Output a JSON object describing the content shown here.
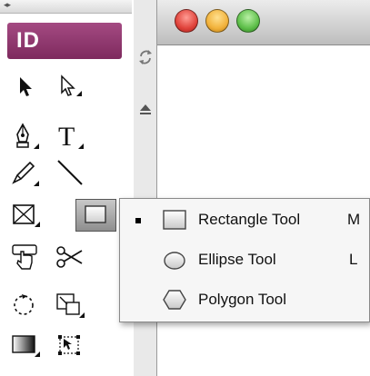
{
  "toolbox": {
    "logo_text": "ID",
    "tools": [
      {
        "name": "selection-tool",
        "icon": "arrow-icon"
      },
      {
        "name": "direct-selection-tool",
        "icon": "hollow-arrow-icon"
      },
      {
        "name": "pen-tool",
        "icon": "pen-icon"
      },
      {
        "name": "type-tool",
        "icon": "type-icon"
      },
      {
        "name": "pencil-tool",
        "icon": "pencil-icon"
      },
      {
        "name": "line-tool",
        "icon": "line-icon"
      },
      {
        "name": "rectangle-frame-tool",
        "icon": "frame-icon"
      },
      {
        "name": "rectangle-tool",
        "icon": "rectangle-icon",
        "selected": true
      },
      {
        "name": "button-tool",
        "icon": "hand-button-icon"
      },
      {
        "name": "scissors-tool",
        "icon": "scissors-icon"
      },
      {
        "name": "rotate-tool",
        "icon": "rotate-icon"
      },
      {
        "name": "scale-tool",
        "icon": "scale-icon"
      },
      {
        "name": "gradient-tool",
        "icon": "gradient-icon"
      },
      {
        "name": "free-transform-tool",
        "icon": "free-transform-icon"
      }
    ]
  },
  "flyout": {
    "items": [
      {
        "label": "Rectangle Tool",
        "shortcut": "M",
        "checked": true,
        "icon": "rectangle-icon"
      },
      {
        "label": "Ellipse Tool",
        "shortcut": "L",
        "checked": false,
        "icon": "ellipse-icon"
      },
      {
        "label": "Polygon Tool",
        "shortcut": "",
        "checked": false,
        "icon": "polygon-icon"
      }
    ]
  },
  "colors": {
    "logo": "#8f3a6e",
    "close": "#e0433b",
    "minimize": "#f2b23b",
    "zoom": "#5ebf4a"
  }
}
